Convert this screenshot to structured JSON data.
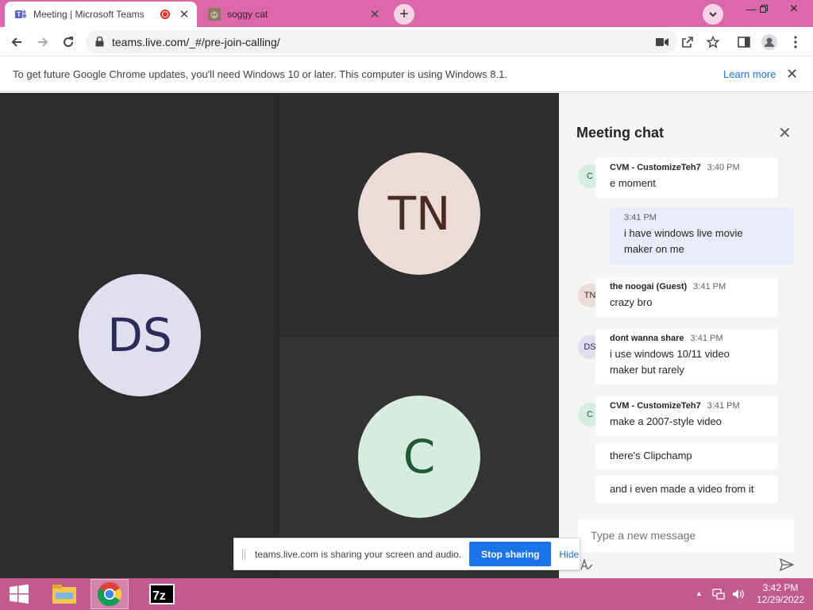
{
  "browser": {
    "tabs": [
      {
        "title": "Meeting | Microsoft Teams",
        "icon": "teams-icon",
        "active": true
      },
      {
        "title": "soggy cat",
        "icon": "cat-thumbnail-icon",
        "active": false
      }
    ],
    "url": "teams.live.com/_#/pre-join-calling/",
    "infobar": {
      "message": "To get future Google Chrome updates, you'll need Windows 10 or later. This computer is using Windows 8.1.",
      "link": "Learn more"
    }
  },
  "meeting": {
    "participants": [
      {
        "initials": "DS",
        "color": "#e0dff0",
        "text_color": "#2b2b59"
      },
      {
        "initials": "TN",
        "color": "#ebdcd7",
        "text_color": "#4a2b21"
      },
      {
        "initials": "C",
        "color": "#d6ecdf",
        "text_color": "#1f5a36"
      }
    ]
  },
  "chat": {
    "title": "Meeting chat",
    "messages": [
      {
        "avatar": "C",
        "author": "CVM - CustomizeTeh7",
        "time": "3:40 PM",
        "lines": [
          "e moment"
        ]
      },
      {
        "self": true,
        "time": "3:41 PM",
        "lines": [
          "i have windows live movie",
          "maker on me"
        ]
      },
      {
        "avatar": "TN",
        "author": "the noogai (Guest)",
        "time": "3:41 PM",
        "lines": [
          "crazy bro"
        ]
      },
      {
        "avatar": "DS",
        "author": "dont wanna share",
        "time": "3:41 PM",
        "lines": [
          "i use windows 10/11 video",
          "maker but rarely"
        ]
      },
      {
        "avatar": "C",
        "author": "CVM - CustomizeTeh7",
        "time": "3:41 PM",
        "lines": [
          "make a 2007-style video"
        ]
      },
      {
        "lines": [
          "there's Clipchamp"
        ]
      },
      {
        "lines": [
          "and i even made a video from it"
        ]
      }
    ],
    "compose_placeholder": "Type a new message"
  },
  "share_bar": {
    "text": "teams.live.com is sharing your screen and audio.",
    "stop_label": "Stop sharing",
    "hide_label": "Hide"
  },
  "taskbar": {
    "apps": [
      "start-icon",
      "file-explorer-icon",
      "chrome-icon",
      "7zip-icon"
    ],
    "time": "3:42 PM",
    "date": "12/29/2022"
  },
  "colors": {
    "tabbar": "#db68a8",
    "taskbar": "#c25a8e",
    "accent": "#1a73e8",
    "chat_self_bubble": "#e8ebfa"
  }
}
